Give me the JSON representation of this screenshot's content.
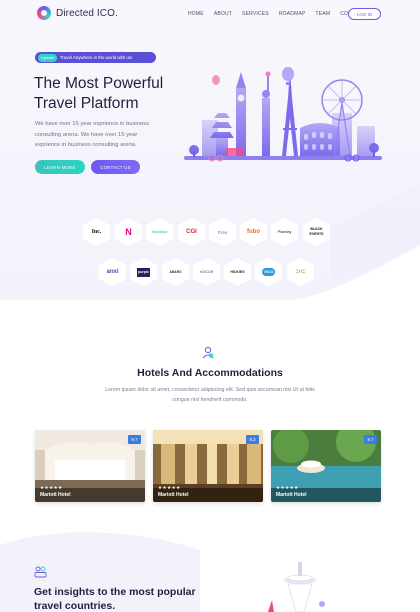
{
  "header": {
    "logo_text": "Directed ICO.",
    "nav": [
      "HOME",
      "ABOUT",
      "SERVICES",
      "ROADMAP",
      "TEAM",
      "CONTACT"
    ],
    "login_label": "LOG IN"
  },
  "hero": {
    "badge_tag": "Update",
    "badge_text": "Travel Anywhere in the world with us!",
    "title_line1": "The Most Powerful",
    "title_line2": "Travel Platform",
    "description": "We have over 15 year exprience in business consulting arena. We have over 15 year exprience in business consulting arena.",
    "learn_more_label": "LEARN MORE",
    "contact_label": "CONTACT US"
  },
  "brands_row1": [
    "Inc.",
    "N",
    "Tripadvisor",
    "CGI",
    "Flow",
    "fubo",
    "Planday",
    "BLACK EVENTS"
  ],
  "brands_row2": [
    "anxi",
    "purple",
    "AMARO",
    "VOCUS",
    "HICKIES",
    "VOCO",
    "⊃⊂"
  ],
  "hotels": {
    "title": "Hotels And Accommodations",
    "description": "Lorem ipsum dolor sit amet, consectetur adipiscing elit. Sed quis accumsan nisi Ut ut felis congue nisl hendrerit commodo.",
    "cards": [
      {
        "name": "Mariott Hotel",
        "rating": "9.7",
        "stars": "★★★★★"
      },
      {
        "name": "Mariott Hotel",
        "rating": "8.3",
        "stars": "★★★★★"
      },
      {
        "name": "Mariott Hotel",
        "rating": "8.7",
        "stars": "★★★★★"
      }
    ]
  },
  "insights": {
    "title_line1": "Get insights to the most popular",
    "title_line2": "travel countries."
  },
  "colors": {
    "accent": "#6e58f0",
    "teal": "#2fd3c7",
    "rating_blue": "#3d7be0"
  }
}
